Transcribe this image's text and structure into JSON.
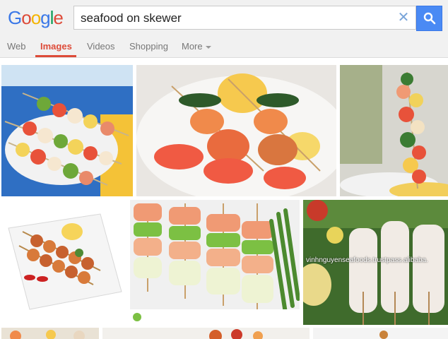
{
  "search": {
    "query": "seafood on skewer",
    "clear_icon": "close-icon",
    "button_icon": "search-icon"
  },
  "logo": {
    "letters": [
      "G",
      "o",
      "o",
      "g",
      "l",
      "e"
    ],
    "colors": [
      "#3b78e7",
      "#dd4b39",
      "#f4b400",
      "#3b78e7",
      "#0f9d58",
      "#dd4b39"
    ]
  },
  "tabs": [
    {
      "label": "Web",
      "active": false
    },
    {
      "label": "Images",
      "active": true
    },
    {
      "label": "Videos",
      "active": false
    },
    {
      "label": "Shopping",
      "active": false
    },
    {
      "label": "More",
      "active": false
    }
  ],
  "colors": {
    "accent": "#dd4b39",
    "button": "#4a8af4"
  },
  "results": {
    "watermark": "vinhnguyenseafoods.trustpass.alibaba."
  }
}
